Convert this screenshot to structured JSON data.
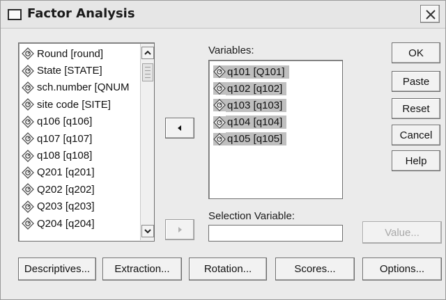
{
  "window": {
    "title": "Factor Analysis",
    "close_glyph": "✕"
  },
  "source_list": {
    "items": [
      {
        "label": "Round [round]",
        "icon": "scale-diamond-icon"
      },
      {
        "label": "State [STATE]",
        "icon": "scale-diamond-icon"
      },
      {
        "label": "sch.number [QNUM",
        "icon": "scale-diamond-icon"
      },
      {
        "label": "site code [SITE]",
        "icon": "scale-diamond-icon"
      },
      {
        "label": "q106 [q106]",
        "icon": "scale-diamond-icon"
      },
      {
        "label": "q107 [q107]",
        "icon": "scale-diamond-icon"
      },
      {
        "label": "q108 [q108]",
        "icon": "scale-diamond-icon"
      },
      {
        "label": "Q201 [q201]",
        "icon": "scale-diamond-icon"
      },
      {
        "label": "Q202 [q202]",
        "icon": "scale-diamond-icon"
      },
      {
        "label": "Q203 [q203]",
        "icon": "scale-diamond-icon"
      },
      {
        "label": "Q204 [q204]",
        "icon": "scale-diamond-icon"
      }
    ]
  },
  "variables": {
    "label": "Variables:",
    "items": [
      {
        "label": "q101 [Q101]",
        "icon": "scale-diamond-icon"
      },
      {
        "label": "q102 [q102]",
        "icon": "scale-diamond-icon"
      },
      {
        "label": "q103 [q103]",
        "icon": "scale-diamond-icon"
      },
      {
        "label": "q104 [q104]",
        "icon": "scale-diamond-icon"
      },
      {
        "label": "q105 [q105]",
        "icon": "scale-diamond-icon"
      }
    ]
  },
  "selection_variable": {
    "label": "Selection Variable:",
    "value": ""
  },
  "buttons": {
    "ok": "OK",
    "paste": "Paste",
    "reset": "Reset",
    "cancel": "Cancel",
    "help": "Help",
    "value": "Value..."
  },
  "bottom_buttons": {
    "descriptives": "Descriptives...",
    "extraction": "Extraction...",
    "rotation": "Rotation...",
    "scores": "Scores...",
    "options": "Options..."
  }
}
